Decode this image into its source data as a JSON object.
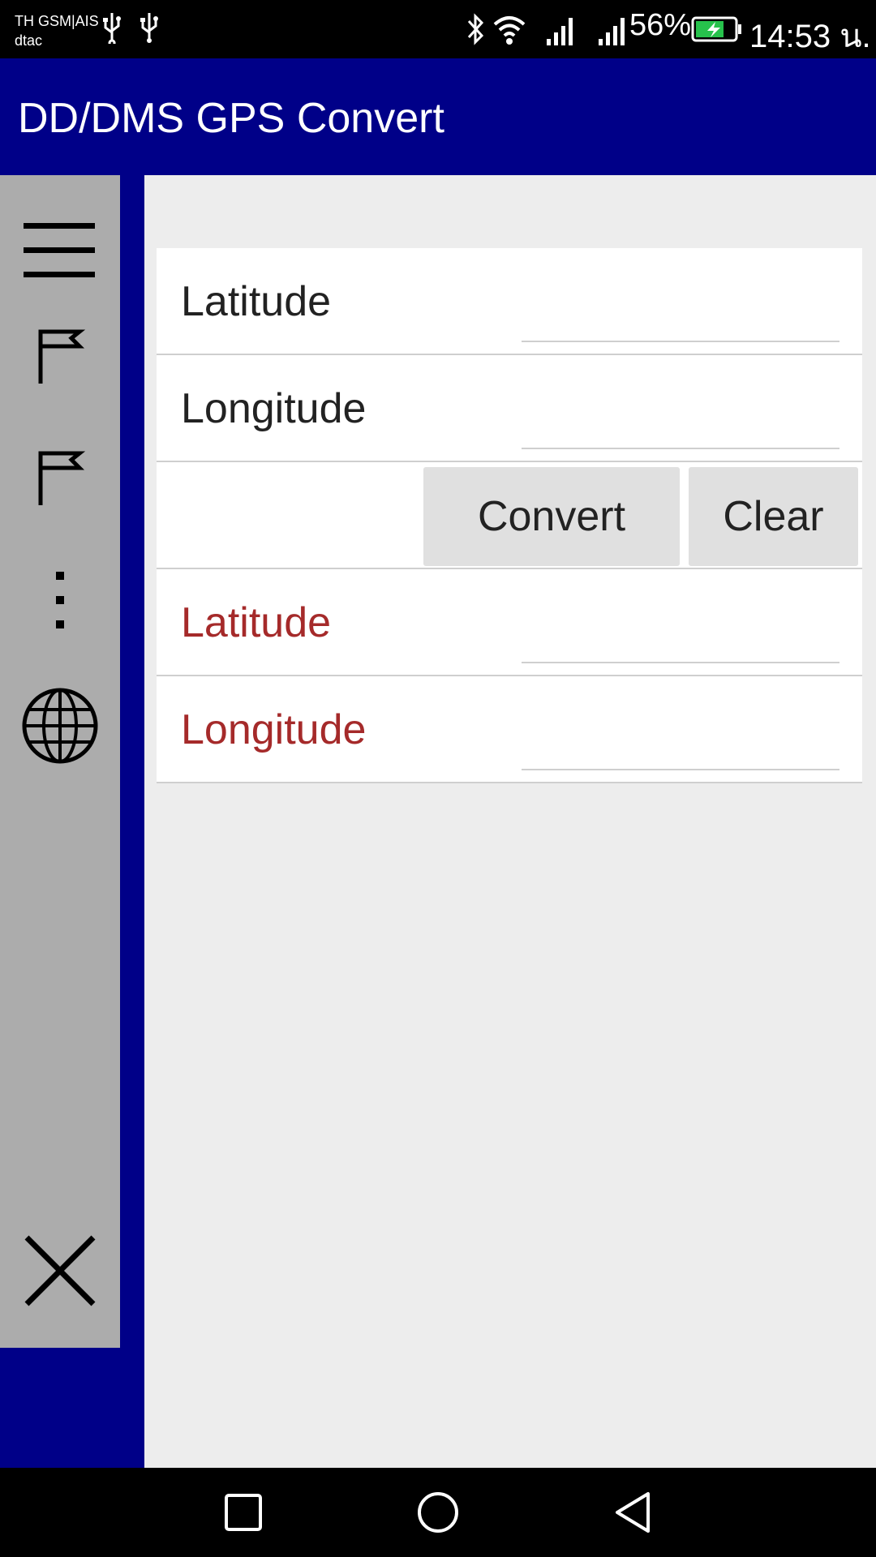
{
  "status_bar": {
    "carrier_line1": "TH GSM|AIS",
    "carrier_line2": "dtac",
    "battery_percent": "56%",
    "time": "14:53 น.",
    "icons": [
      "usb-icon",
      "usb-icon",
      "bluetooth-icon",
      "wifi-icon",
      "signal-icon",
      "signal-icon",
      "battery-charging-icon"
    ]
  },
  "app_bar": {
    "title": "DD/DMS GPS Convert"
  },
  "sidebar": {
    "items": [
      {
        "icon": "menu-icon"
      },
      {
        "icon": "flag-icon"
      },
      {
        "icon": "flag-icon"
      },
      {
        "icon": "more-vertical-icon"
      },
      {
        "icon": "globe-icon"
      },
      {
        "icon": "close-icon"
      }
    ]
  },
  "form": {
    "input_latitude_label": "Latitude",
    "input_longitude_label": "Longitude",
    "convert_label": "Convert",
    "clear_label": "Clear",
    "output_latitude_label": "Latitude",
    "output_longitude_label": "Longitude",
    "input_latitude_value": "",
    "input_longitude_value": "",
    "output_latitude_value": "",
    "output_longitude_value": ""
  },
  "colors": {
    "app_bar": "#000088",
    "sidebar": "#acacac",
    "output_label": "#a52a2a",
    "button": "#e0e0e0"
  }
}
